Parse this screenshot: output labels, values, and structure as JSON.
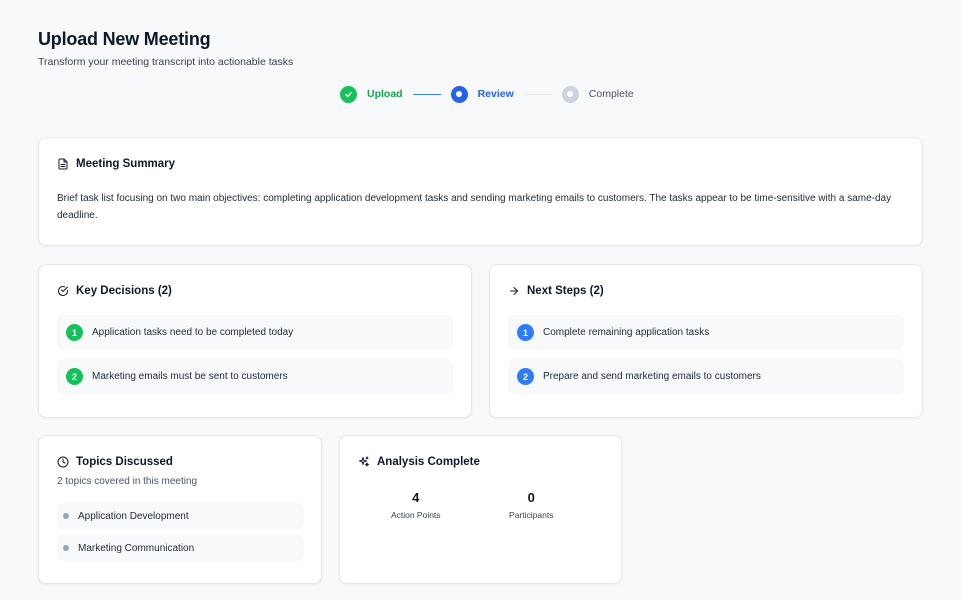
{
  "header": {
    "title": "Upload New Meeting",
    "subtitle": "Transform your meeting transcript into actionable tasks"
  },
  "stepper": {
    "steps": [
      {
        "label": "Upload",
        "state": "done"
      },
      {
        "label": "Review",
        "state": "active"
      },
      {
        "label": "Complete",
        "state": "pending"
      }
    ]
  },
  "summary": {
    "title": "Meeting Summary",
    "icon": "document-icon",
    "text": "Brief task list focusing on two main objectives: completing application development tasks and sending marketing emails to customers. The tasks appear to be time-sensitive with a same-day deadline."
  },
  "decisions": {
    "title": "Key Decisions (2)",
    "icon": "check-circle-icon",
    "items": [
      {
        "num": "1",
        "text": "Application tasks need to be completed today"
      },
      {
        "num": "2",
        "text": "Marketing emails must be sent to customers"
      }
    ]
  },
  "next_steps": {
    "title": "Next Steps (2)",
    "icon": "arrow-right-icon",
    "items": [
      {
        "num": "1",
        "text": "Complete remaining application tasks"
      },
      {
        "num": "2",
        "text": "Prepare and send marketing emails to customers"
      }
    ]
  },
  "topics": {
    "title": "Topics Discussed",
    "icon": "clock-icon",
    "subtitle": "2 topics covered in this meeting",
    "items": [
      {
        "text": "Application Development"
      },
      {
        "text": "Marketing Communication"
      }
    ]
  },
  "analysis": {
    "title": "Analysis Complete",
    "icon": "sparkles-icon",
    "stats": [
      {
        "value": "4",
        "label": "Action Points"
      },
      {
        "value": "0",
        "label": "Participants"
      }
    ]
  },
  "colors": {
    "success": "#16c15a",
    "primary": "#2563eb",
    "pending": "#cbd5e1"
  }
}
